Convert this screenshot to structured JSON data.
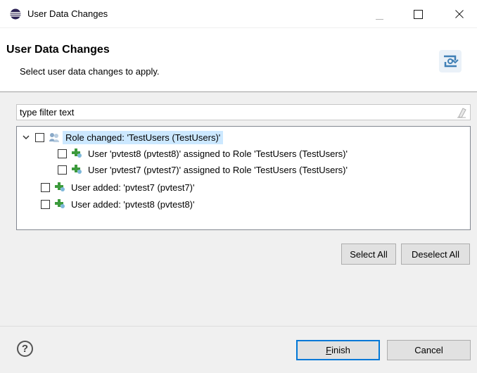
{
  "window": {
    "title": "User Data Changes",
    "icon": "eclipse-icon"
  },
  "header": {
    "title": "User Data Changes",
    "message": "Select user data changes to apply.",
    "banner_icon": "sync-icon"
  },
  "filter": {
    "placeholder": "type filter text",
    "value": "type filter text"
  },
  "tree": {
    "rows": [
      {
        "label": "Role changed: 'TestUsers (TestUsers)'",
        "checked": false,
        "expanded": true,
        "selected": true,
        "icon": "role-icon",
        "level": 0
      },
      {
        "label": "User 'pvtest8 (pvtest8)' assigned to Role 'TestUsers (TestUsers)'",
        "checked": false,
        "icon": "user-add-icon",
        "level": 1
      },
      {
        "label": "User 'pvtest7 (pvtest7)' assigned to Role 'TestUsers (TestUsers)'",
        "checked": false,
        "icon": "user-add-icon",
        "level": 1
      },
      {
        "label": "User added: 'pvtest7 (pvtest7)'",
        "checked": false,
        "icon": "user-add-icon",
        "level": 0
      },
      {
        "label": "User added: 'pvtest8 (pvtest8)'",
        "checked": false,
        "icon": "user-add-icon",
        "level": 0
      }
    ]
  },
  "buttons": {
    "select_all": "Select All",
    "deselect_all": "Deselect All",
    "finish_mnemonic": "F",
    "finish_rest": "inish",
    "cancel": "Cancel"
  },
  "help": "?"
}
